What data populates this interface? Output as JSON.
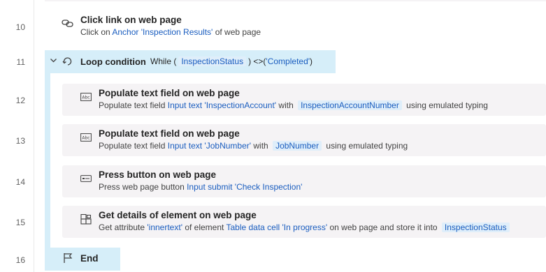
{
  "line_numbers": [
    "10",
    "11",
    "12",
    "13",
    "14",
    "15",
    "16"
  ],
  "steps": {
    "click_link": {
      "title": "Click link on web page",
      "desc_prefix": "Click on ",
      "desc_link": "Anchor 'Inspection Results'",
      "desc_suffix": " of web page"
    },
    "loop": {
      "title": "Loop condition",
      "cond_prefix": "While (",
      "cond_var": "InspectionStatus",
      "cond_op": ") <>(",
      "cond_value": "'Completed'",
      "cond_close": ")"
    },
    "populate1": {
      "title": "Populate text field on web page",
      "desc_prefix": "Populate text field ",
      "desc_link": "Input text 'InspectionAccount'",
      "desc_mid": " with ",
      "desc_var": "InspectionAccountNumber",
      "desc_suffix": " using emulated typing"
    },
    "populate2": {
      "title": "Populate text field on web page",
      "desc_prefix": "Populate text field ",
      "desc_link": "Input text 'JobNumber'",
      "desc_mid": " with ",
      "desc_var": "JobNumber",
      "desc_suffix": " using emulated typing"
    },
    "press_button": {
      "title": "Press button on web page",
      "desc_prefix": "Press web page button ",
      "desc_link": "Input submit 'Check Inspection'"
    },
    "get_details": {
      "title": "Get details of element on web page",
      "desc_prefix": "Get attribute ",
      "desc_link1": "'innertext'",
      "desc_mid1": " of element ",
      "desc_link2": "Table data cell 'In progress'",
      "desc_mid2": " on web page and store it into ",
      "desc_var": "InspectionStatus"
    },
    "end": {
      "title": "End"
    }
  },
  "colors": {
    "accent_link": "#1a5dbf",
    "loop_highlight": "#d6eef9",
    "card_bg": "#f5f3f5"
  }
}
